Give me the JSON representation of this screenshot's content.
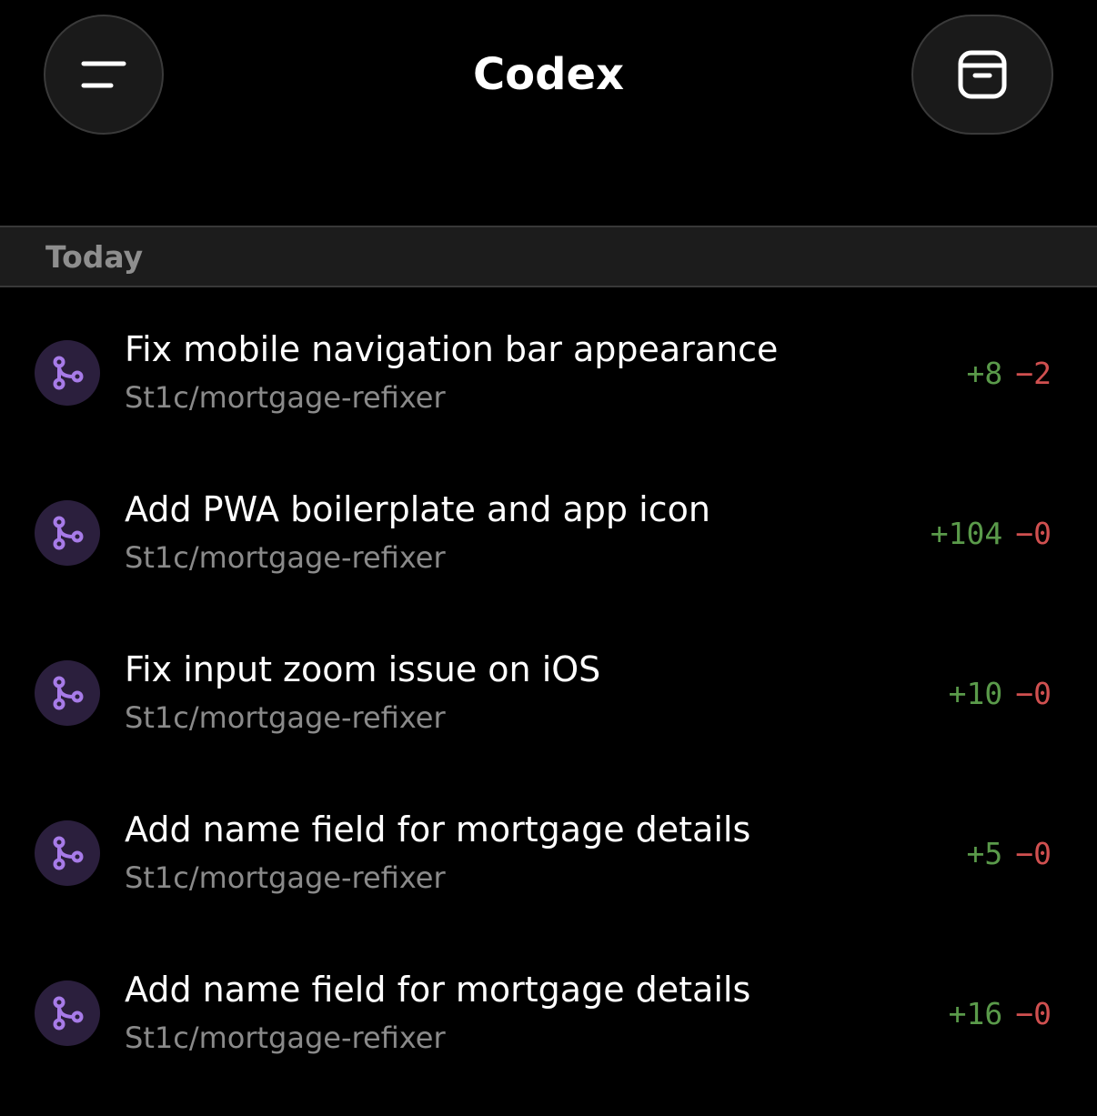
{
  "header": {
    "title": "Codex",
    "menu_icon": "menu-icon",
    "archive_icon": "archive-icon"
  },
  "section": {
    "label": "Today"
  },
  "tasks": [
    {
      "title": "Fix mobile navigation bar appearance",
      "repo": "St1c/mortgage-refixer",
      "additions": "+8",
      "deletions": "−2",
      "icon": "branch-icon"
    },
    {
      "title": "Add PWA boilerplate and app icon",
      "repo": "St1c/mortgage-refixer",
      "additions": "+104",
      "deletions": "−0",
      "icon": "branch-icon"
    },
    {
      "title": "Fix input zoom issue on iOS",
      "repo": "St1c/mortgage-refixer",
      "additions": "+10",
      "deletions": "−0",
      "icon": "branch-icon"
    },
    {
      "title": "Add name field for mortgage details",
      "repo": "St1c/mortgage-refixer",
      "additions": "+5",
      "deletions": "−0",
      "icon": "branch-icon"
    },
    {
      "title": "Add name field for mortgage details",
      "repo": "St1c/mortgage-refixer",
      "additions": "+16",
      "deletions": "−0",
      "icon": "branch-icon"
    }
  ],
  "colors": {
    "background": "#000000",
    "section_bg": "#1c1c1c",
    "additions": "#5a9a4a",
    "deletions": "#d05050",
    "icon_accent": "#a77be8",
    "icon_bg": "#2b1f3d"
  }
}
